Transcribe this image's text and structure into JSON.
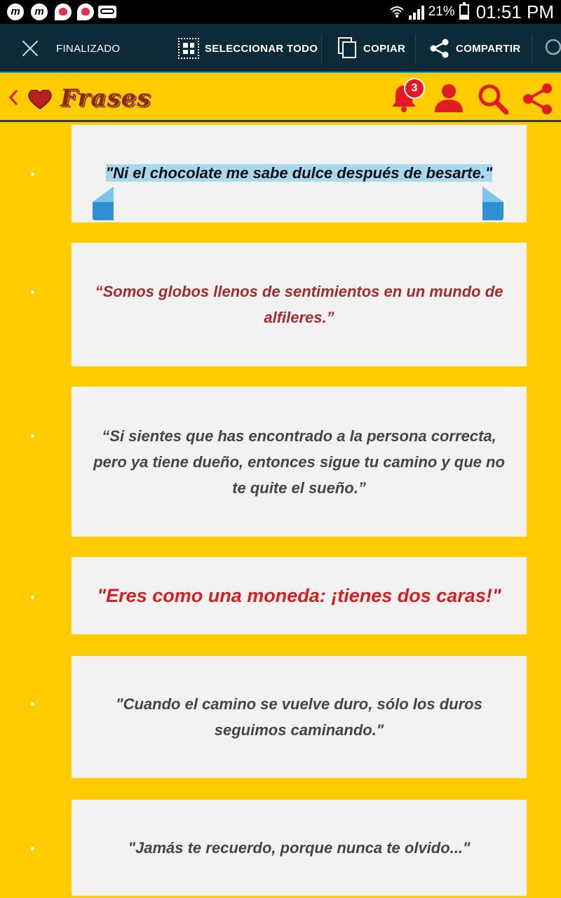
{
  "status_bar": {
    "notif_icons": [
      "m-icon",
      "m-icon",
      "heart-message-icon",
      "heart-message-icon",
      "voicemail-icon"
    ],
    "battery_percent": "21%",
    "time": "01:51 PM"
  },
  "action_bar": {
    "close_label": "FINALIZADO",
    "select_all_label": "SELECCIONAR TODO",
    "copy_label": "COPIAR",
    "share_label": "COMPARTIR"
  },
  "header": {
    "title": "Frases",
    "notification_count": "3",
    "colors": {
      "accent": "#ffcc00",
      "icon": "#e21b23",
      "title": "#8b2a18"
    }
  },
  "quotes": [
    {
      "text": "\"Ni el chocolate me sabe dulce después de besarte.\""
    },
    {
      "text": "“Somos globos llenos de sentimientos en un mundo de alfileres.”"
    },
    {
      "text": "“Si sientes que has encontrado a la persona correcta, pero ya tiene dueño, entonces sigue tu camino y que no te quite el sueño.”"
    },
    {
      "text": "\"Eres como una moneda: ¡tienes dos caras!\""
    },
    {
      "text": "\"Cuando el camino se vuelve duro, sólo los duros seguimos caminando.\""
    },
    {
      "text": "\"Jamás te recuerdo, porque nunca te olvido...\""
    }
  ]
}
